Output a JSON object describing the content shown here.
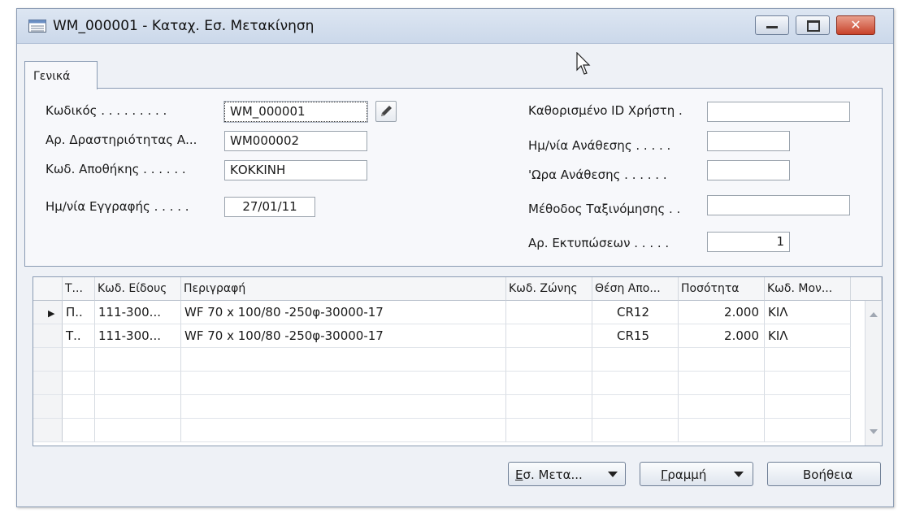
{
  "window": {
    "title": "WM_000001 - Καταχ. Εσ. Μετακίνηση",
    "controls": {
      "minimize": "minimize-button",
      "maximize": "maximize-button",
      "close": "close-button"
    },
    "close_glyph": "✕"
  },
  "tabs": [
    {
      "label": "Γενικά"
    }
  ],
  "form": {
    "left": [
      {
        "label": "Κωδικός . . . . . . . . .",
        "value": "WM_000001"
      },
      {
        "label": "Αρ. Δραστηριότητας Α...",
        "value": "WM000002"
      },
      {
        "label": "Κωδ. Αποθήκης . . . . . .",
        "value": "ΚΟΚΚΙΝΗ"
      },
      {
        "label": "Ημ/νία Εγγραφής . . . . .",
        "value": "27/01/11"
      }
    ],
    "right": [
      {
        "label": "Καθορισμένο ID Χρήστη .",
        "value": ""
      },
      {
        "label": "Ημ/νία Ανάθεσης . . . . .",
        "value": ""
      },
      {
        "label": "'Ωρα Ανάθεσης . . . . . .",
        "value": ""
      },
      {
        "label": "Μέθοδος Ταξινόμησης . .",
        "value": ""
      },
      {
        "label": "Αρ. Εκτυπώσεων . . . . .",
        "value": "1"
      }
    ]
  },
  "lines": {
    "columns": [
      "Τ...",
      "Κωδ. Είδους",
      "Περιγραφή",
      "Κωδ. Ζώνης",
      "Θέση Απο...",
      "Ποσότητα",
      "Κωδ. Μον..."
    ],
    "row_marker": "▶",
    "rows": [
      [
        "Π..",
        "111-300...",
        "WF 70 x 100/80 -250φ-30000-17",
        "",
        "CR12",
        "2.000",
        "ΚΙΛ"
      ],
      [
        "Τ..",
        "111-300...",
        "WF 70 x 100/80 -250φ-30000-17",
        "",
        "CR15",
        "2.000",
        "ΚΙΛ"
      ]
    ]
  },
  "buttons": {
    "movement": {
      "underlined": "Ε",
      "rest": "σ. Μετα..."
    },
    "line": {
      "underlined": "Γ",
      "rest": "ραμμή"
    },
    "help": {
      "label": "Βοήθεια"
    }
  }
}
